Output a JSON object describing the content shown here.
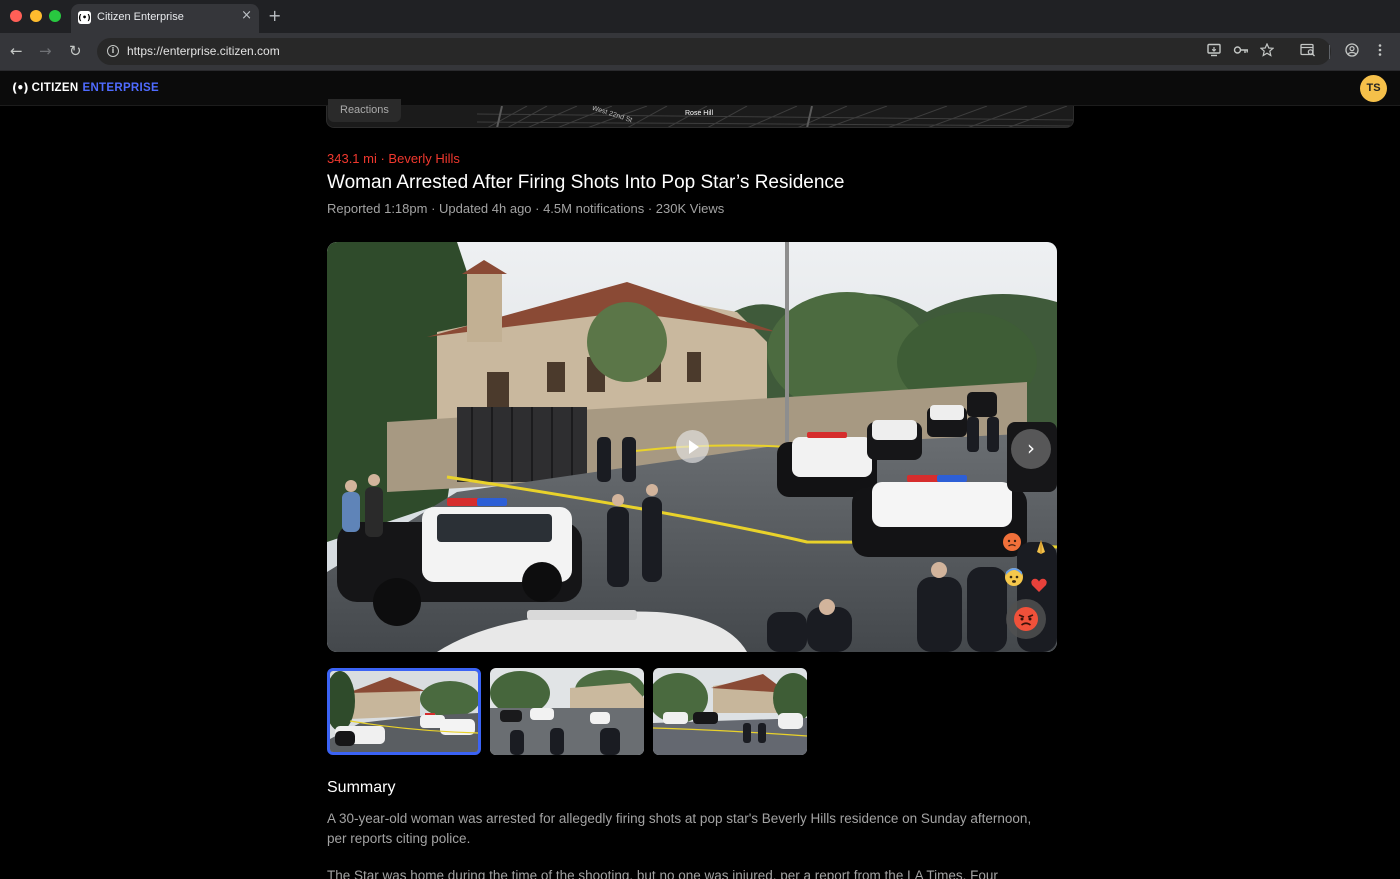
{
  "browser": {
    "tab_title": "Citizen Enterprise",
    "tab_close": "×",
    "new_tab": "+",
    "url": "https://enterprise.citizen.com",
    "nav": {
      "back": "←",
      "forward": "→",
      "reload": "↻"
    },
    "toolbar_icons": [
      "install-app-icon",
      "key-icon",
      "star-icon",
      "tab-search-icon",
      "profile-icon",
      "menu-icon"
    ]
  },
  "app": {
    "logo_mark": "(•)",
    "logo_citizen": "CITIZEN",
    "logo_enterprise": "ENTERPRISE",
    "avatar_initials": "TS",
    "brand_color": "#4f6bff",
    "avatar_color": "#f5c04a"
  },
  "map": {
    "reactions_label": "Reactions",
    "street_labels": [
      "West 22nd St",
      "Rose Hill"
    ]
  },
  "incident": {
    "location": "343.1 mi · Beverly Hills",
    "title": "Woman Arrested After Firing Shots Into Pop Star’s Residence",
    "meta": "Reported 1:18pm · Updated 4h ago · 4.5M notifications · 230K Views",
    "location_color": "#f0382e"
  },
  "media": {
    "gallery_count": 3,
    "active_index": 0,
    "next_glyph": "›",
    "reactions": [
      "angry-emoji",
      "fearful-emoji",
      "heart-emoji",
      "pray-emoji",
      "angry-emoji"
    ]
  },
  "summary": {
    "heading": "Summary",
    "paragraphs": [
      "A 30-year-old woman was arrested for allegedly firing shots at pop star's Beverly Hills residence on Sunday afternoon, per reports citing police.",
      "The Star was home during the time of the shooting, but no one was injured, per a report from the LA Times. Four"
    ]
  }
}
